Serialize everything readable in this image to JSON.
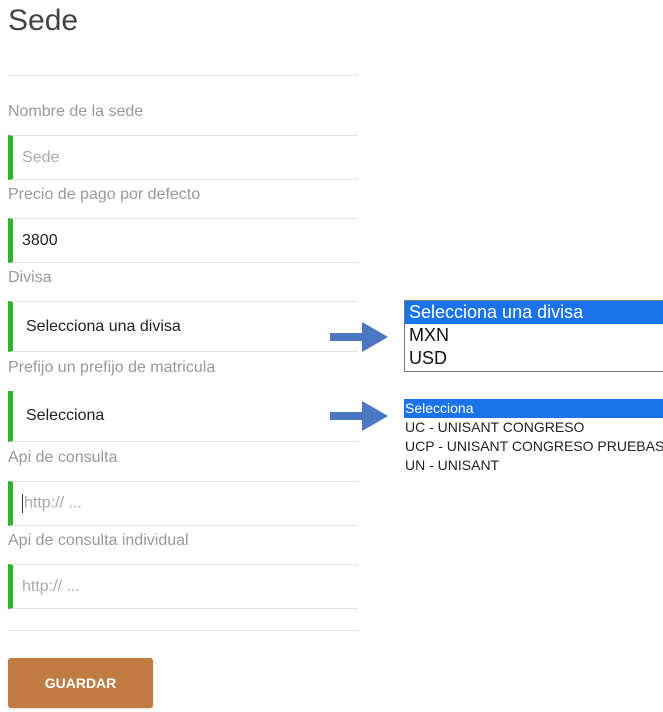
{
  "page": {
    "title": "Sede"
  },
  "form": {
    "nombre": {
      "label": "Nombre de la sede",
      "placeholder": "Sede"
    },
    "precio": {
      "label": "Precio de pago por defecto",
      "value": "3800"
    },
    "divisa": {
      "label": "Divisa",
      "selected": "Selecciona una divisa"
    },
    "prefijo": {
      "label": "Prefijo un prefijo de matricula",
      "selected": "Selecciona"
    },
    "api": {
      "label": "Api de consulta",
      "placeholder": "http:// ..."
    },
    "api_individual": {
      "label": "Api de consulta individual",
      "placeholder": "http:// ..."
    },
    "save_label": "GUARDAR"
  },
  "divisa_dropdown": {
    "options": [
      "Selecciona una divisa",
      "MXN",
      "USD"
    ],
    "highlighted": "Selecciona una divisa"
  },
  "prefijo_dropdown": {
    "options": [
      "Selecciona",
      "UC - UNISANT CONGRESO",
      "UCP - UNISANT CONGRESO PRUEBAS",
      "UN - UNISANT"
    ],
    "highlighted": "Selecciona"
  },
  "colors": {
    "accent": "#2db52d",
    "button": "#c07b43",
    "highlight": "#1a73e8",
    "arrow": "#4a76c2"
  }
}
